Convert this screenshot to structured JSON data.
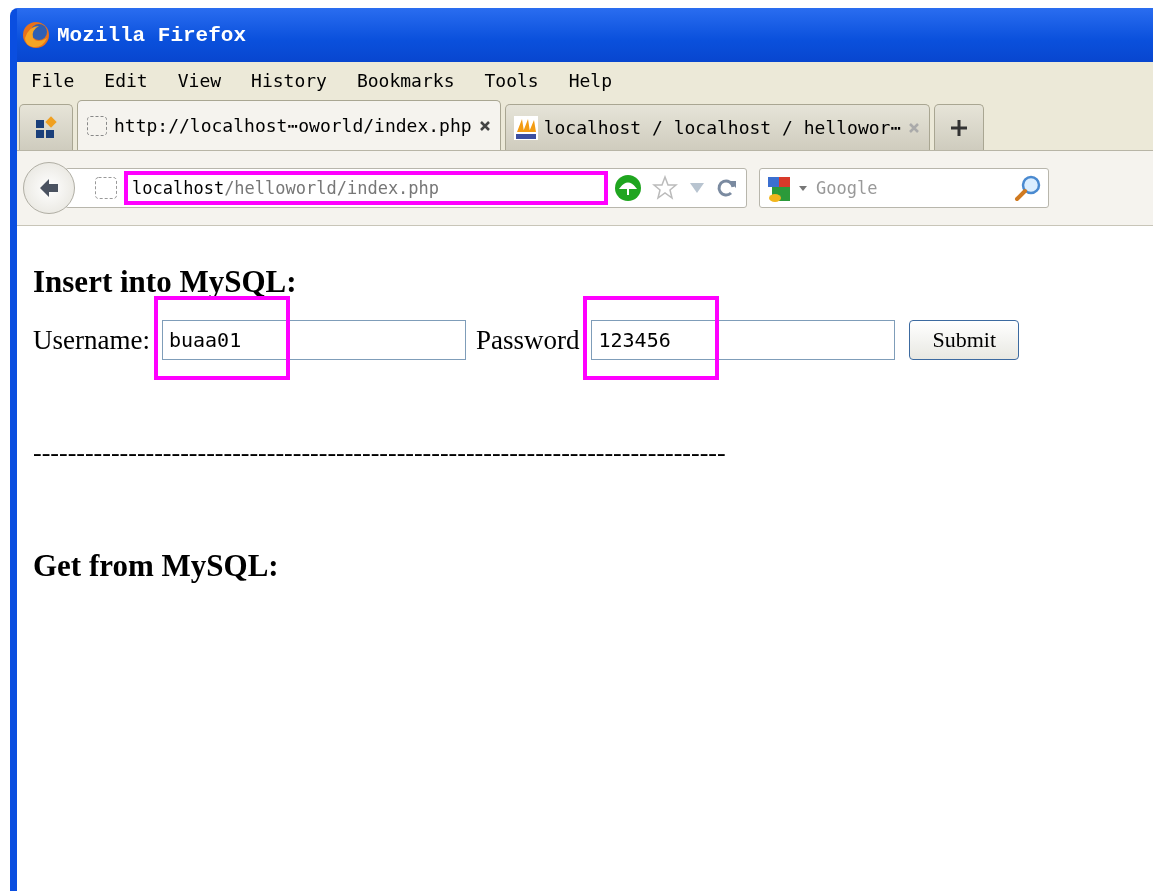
{
  "window": {
    "title": "Mozilla Firefox"
  },
  "menu": [
    {
      "label": "File"
    },
    {
      "label": "Edit"
    },
    {
      "label": "View"
    },
    {
      "label": "History"
    },
    {
      "label": "Bookmarks"
    },
    {
      "label": "Tools"
    },
    {
      "label": "Help"
    }
  ],
  "tabs": [
    {
      "label": "http://localhost⋯oworld/index.php",
      "selected": true,
      "kind": "blank"
    },
    {
      "label": "localhost / localhost / hellowor⋯",
      "selected": false,
      "kind": "pma"
    }
  ],
  "address_bar": {
    "host": "localhost",
    "path": "/helloworld/index.php",
    "highlighted": true
  },
  "search": {
    "placeholder": "Google"
  },
  "page": {
    "insert_heading": "Insert into MySQL:",
    "username": {
      "label": "Username:",
      "value": "buaa01",
      "highlighted": true
    },
    "password": {
      "label": "Password",
      "value": "123456",
      "highlighted": true
    },
    "submit": "Submit",
    "separator": "--------------------------------------------------------------------------------",
    "get_heading": "Get from MySQL:"
  }
}
